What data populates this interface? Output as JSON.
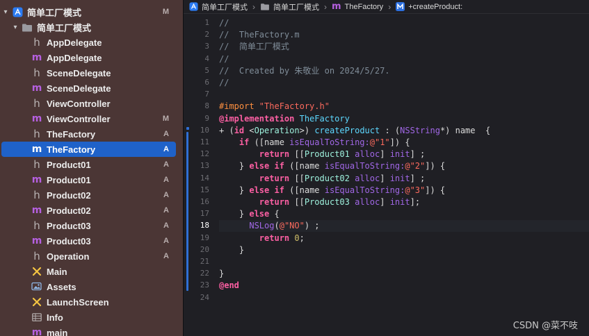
{
  "navigator": {
    "items": [
      {
        "label": "简单工厂模式",
        "icon": "project-icon",
        "badge": "M",
        "disclosure": "▾"
      },
      {
        "label": "简单工厂模式",
        "icon": "folder-icon",
        "badge": "",
        "disclosure": "▾"
      },
      {
        "label": "AppDelegate",
        "icon": "header-file-icon",
        "badge": ""
      },
      {
        "label": "AppDelegate",
        "icon": "objc-file-icon",
        "badge": ""
      },
      {
        "label": "SceneDelegate",
        "icon": "header-file-icon",
        "badge": ""
      },
      {
        "label": "SceneDelegate",
        "icon": "objc-file-icon",
        "badge": ""
      },
      {
        "label": "ViewController",
        "icon": "header-file-icon",
        "badge": ""
      },
      {
        "label": "ViewController",
        "icon": "objc-file-icon",
        "badge": "M"
      },
      {
        "label": "TheFactory",
        "icon": "header-file-icon",
        "badge": "A"
      },
      {
        "label": "TheFactory",
        "icon": "objc-file-icon",
        "badge": "A"
      },
      {
        "label": "Product01",
        "icon": "header-file-icon",
        "badge": "A"
      },
      {
        "label": "Product01",
        "icon": "objc-file-icon",
        "badge": "A"
      },
      {
        "label": "Product02",
        "icon": "header-file-icon",
        "badge": "A"
      },
      {
        "label": "Product02",
        "icon": "objc-file-icon",
        "badge": "A"
      },
      {
        "label": "Product03",
        "icon": "header-file-icon",
        "badge": "A"
      },
      {
        "label": "Product03",
        "icon": "objc-file-icon",
        "badge": "A"
      },
      {
        "label": "Operation",
        "icon": "header-file-icon",
        "badge": "A"
      },
      {
        "label": "Main",
        "icon": "storyboard-icon",
        "badge": ""
      },
      {
        "label": "Assets",
        "icon": "asset-catalog-icon",
        "badge": ""
      },
      {
        "label": "LaunchScreen",
        "icon": "storyboard-icon",
        "badge": ""
      },
      {
        "label": "Info",
        "icon": "plist-icon",
        "badge": ""
      },
      {
        "label": "main",
        "icon": "objc-file-icon",
        "badge": ""
      }
    ]
  },
  "jumpbar": {
    "crumbs": [
      {
        "label": "简单工厂模式",
        "icon": "project-icon"
      },
      {
        "label": "简单工厂模式",
        "icon": "folder-icon"
      },
      {
        "label": "TheFactory",
        "icon": "objc-file-icon"
      },
      {
        "label": "+createProduct:",
        "icon": "method-icon"
      }
    ]
  },
  "editor": {
    "current_line": 18,
    "line_numbers": [
      "1",
      "2",
      "3",
      "4",
      "5",
      "6",
      "7",
      "8",
      "9",
      "10",
      "11",
      "12",
      "13",
      "14",
      "15",
      "16",
      "17",
      "18",
      "19",
      "20",
      "21",
      "22",
      "23",
      "24"
    ],
    "lines": [
      [
        {
          "t": "//",
          "c": "c-comment"
        }
      ],
      [
        {
          "t": "//  TheFactory.m",
          "c": "c-comment"
        }
      ],
      [
        {
          "t": "//  简单工厂模式",
          "c": "c-comment"
        }
      ],
      [
        {
          "t": "//",
          "c": "c-comment"
        }
      ],
      [
        {
          "t": "//  Created by 朱敬业 on 2024/5/27.",
          "c": "c-comment"
        }
      ],
      [
        {
          "t": "//",
          "c": "c-comment"
        }
      ],
      [],
      [
        {
          "t": "#import ",
          "c": "c-pre"
        },
        {
          "t": "\"TheFactory.h\"",
          "c": "c-str"
        }
      ],
      [
        {
          "t": "@implementation",
          "c": "c-kw"
        },
        {
          "t": " ",
          "c": "c-plain"
        },
        {
          "t": "TheFactory",
          "c": "c-type"
        }
      ],
      [
        {
          "t": "+ (",
          "c": "c-plain"
        },
        {
          "t": "id",
          "c": "c-kw"
        },
        {
          "t": " <",
          "c": "c-plain"
        },
        {
          "t": "Operation",
          "c": "c-class"
        },
        {
          "t": ">) ",
          "c": "c-plain"
        },
        {
          "t": "createProduct",
          "c": "c-type"
        },
        {
          "t": " : (",
          "c": "c-plain"
        },
        {
          "t": "NSString",
          "c": "c-sys"
        },
        {
          "t": "*) name  {",
          "c": "c-plain"
        }
      ],
      [
        {
          "t": "    ",
          "c": "c-plain"
        },
        {
          "t": "if",
          "c": "c-kw"
        },
        {
          "t": " ([name ",
          "c": "c-plain"
        },
        {
          "t": "isEqualToString:",
          "c": "c-sys"
        },
        {
          "t": "@\"1\"",
          "c": "c-str"
        },
        {
          "t": "]) {",
          "c": "c-plain"
        }
      ],
      [
        {
          "t": "        ",
          "c": "c-plain"
        },
        {
          "t": "return",
          "c": "c-kw"
        },
        {
          "t": " [[",
          "c": "c-plain"
        },
        {
          "t": "Product01",
          "c": "c-class"
        },
        {
          "t": " ",
          "c": "c-plain"
        },
        {
          "t": "alloc",
          "c": "c-sys"
        },
        {
          "t": "] ",
          "c": "c-plain"
        },
        {
          "t": "init",
          "c": "c-sys"
        },
        {
          "t": "] ;",
          "c": "c-plain"
        }
      ],
      [
        {
          "t": "    } ",
          "c": "c-plain"
        },
        {
          "t": "else",
          "c": "c-kw"
        },
        {
          "t": " ",
          "c": "c-plain"
        },
        {
          "t": "if",
          "c": "c-kw"
        },
        {
          "t": " ([name ",
          "c": "c-plain"
        },
        {
          "t": "isEqualToString:",
          "c": "c-sys"
        },
        {
          "t": "@\"2\"",
          "c": "c-str"
        },
        {
          "t": "]) {",
          "c": "c-plain"
        }
      ],
      [
        {
          "t": "        ",
          "c": "c-plain"
        },
        {
          "t": "return",
          "c": "c-kw"
        },
        {
          "t": " [[",
          "c": "c-plain"
        },
        {
          "t": "Product02",
          "c": "c-class"
        },
        {
          "t": " ",
          "c": "c-plain"
        },
        {
          "t": "alloc",
          "c": "c-sys"
        },
        {
          "t": "] ",
          "c": "c-plain"
        },
        {
          "t": "init",
          "c": "c-sys"
        },
        {
          "t": "] ;",
          "c": "c-plain"
        }
      ],
      [
        {
          "t": "    } ",
          "c": "c-plain"
        },
        {
          "t": "else",
          "c": "c-kw"
        },
        {
          "t": " ",
          "c": "c-plain"
        },
        {
          "t": "if",
          "c": "c-kw"
        },
        {
          "t": " ([name ",
          "c": "c-plain"
        },
        {
          "t": "isEqualToString:",
          "c": "c-sys"
        },
        {
          "t": "@\"3\"",
          "c": "c-str"
        },
        {
          "t": "]) {",
          "c": "c-plain"
        }
      ],
      [
        {
          "t": "        ",
          "c": "c-plain"
        },
        {
          "t": "return",
          "c": "c-kw"
        },
        {
          "t": " [[",
          "c": "c-plain"
        },
        {
          "t": "Product03",
          "c": "c-class"
        },
        {
          "t": " ",
          "c": "c-plain"
        },
        {
          "t": "alloc",
          "c": "c-sys"
        },
        {
          "t": "] ",
          "c": "c-plain"
        },
        {
          "t": "init",
          "c": "c-sys"
        },
        {
          "t": "];",
          "c": "c-plain"
        }
      ],
      [
        {
          "t": "    } ",
          "c": "c-plain"
        },
        {
          "t": "else",
          "c": "c-kw"
        },
        {
          "t": " {",
          "c": "c-plain"
        }
      ],
      [
        {
          "t": "      ",
          "c": "c-plain"
        },
        {
          "t": "NSLog",
          "c": "c-sys"
        },
        {
          "t": "(",
          "c": "c-plain"
        },
        {
          "t": "@\"NO\"",
          "c": "c-str"
        },
        {
          "t": ") ;",
          "c": "c-plain"
        }
      ],
      [
        {
          "t": "        ",
          "c": "c-plain"
        },
        {
          "t": "return",
          "c": "c-kw"
        },
        {
          "t": " ",
          "c": "c-plain"
        },
        {
          "t": "0",
          "c": "c-num"
        },
        {
          "t": ";",
          "c": "c-plain"
        }
      ],
      [
        {
          "t": "    }",
          "c": "c-plain"
        }
      ],
      [],
      [
        {
          "t": "}",
          "c": "c-plain"
        }
      ],
      [
        {
          "t": "@end",
          "c": "c-kw"
        }
      ],
      []
    ]
  },
  "watermark": "CSDN @菜不吱",
  "colors": {
    "sidebar_bg": "#4b3635",
    "selection": "#1f62c9",
    "editor_bg": "#1f1f24",
    "accent": "#2f6fd6"
  }
}
